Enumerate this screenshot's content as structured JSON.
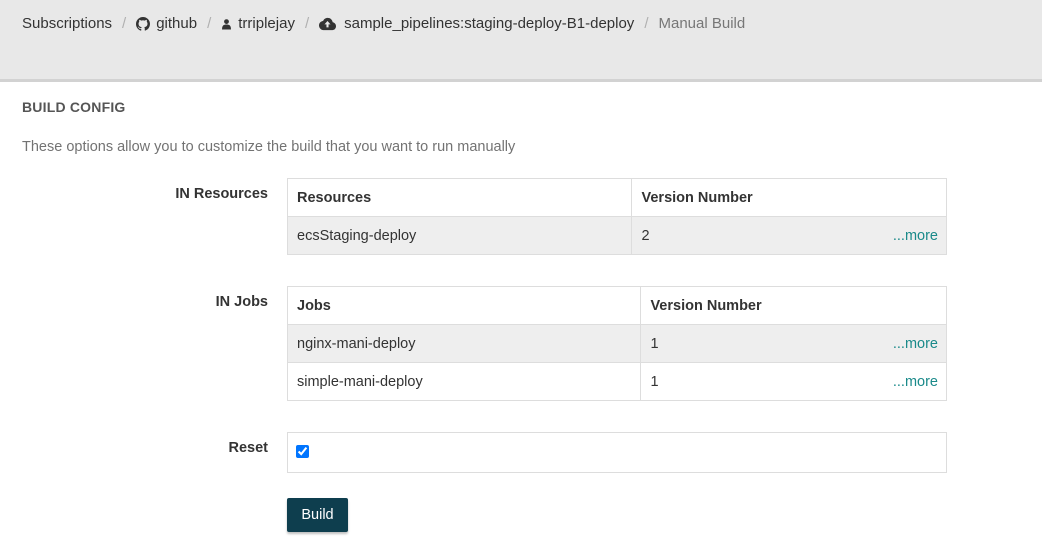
{
  "breadcrumb": {
    "subscriptions": "Subscriptions",
    "provider": "github",
    "user": "trriplejay",
    "pipeline": "sample_pipelines:staging-deploy-B1-deploy",
    "current": "Manual Build",
    "separator": "/"
  },
  "panel": {
    "title": "BUILD CONFIG",
    "description": "These options allow you to customize the build that you want to run manually"
  },
  "in_resources": {
    "label": "IN Resources",
    "headers": [
      "Resources",
      "Version Number"
    ],
    "rows": [
      {
        "name": "ecsStaging-deploy",
        "version": "2",
        "more": "...more"
      }
    ]
  },
  "in_jobs": {
    "label": "IN Jobs",
    "headers": [
      "Jobs",
      "Version Number"
    ],
    "rows": [
      {
        "name": "nginx-mani-deploy",
        "version": "1",
        "more": "...more"
      },
      {
        "name": "simple-mani-deploy",
        "version": "1",
        "more": "...more"
      }
    ]
  },
  "reset": {
    "label": "Reset",
    "checked": true
  },
  "build_button": "Build",
  "colors": {
    "topbar": "#e8e8e8",
    "button": "#0e3e4e",
    "link": "#1a8a8a"
  },
  "icons": {
    "provider": "github-icon",
    "user": "user-icon",
    "pipeline": "cloud-upload-icon"
  }
}
